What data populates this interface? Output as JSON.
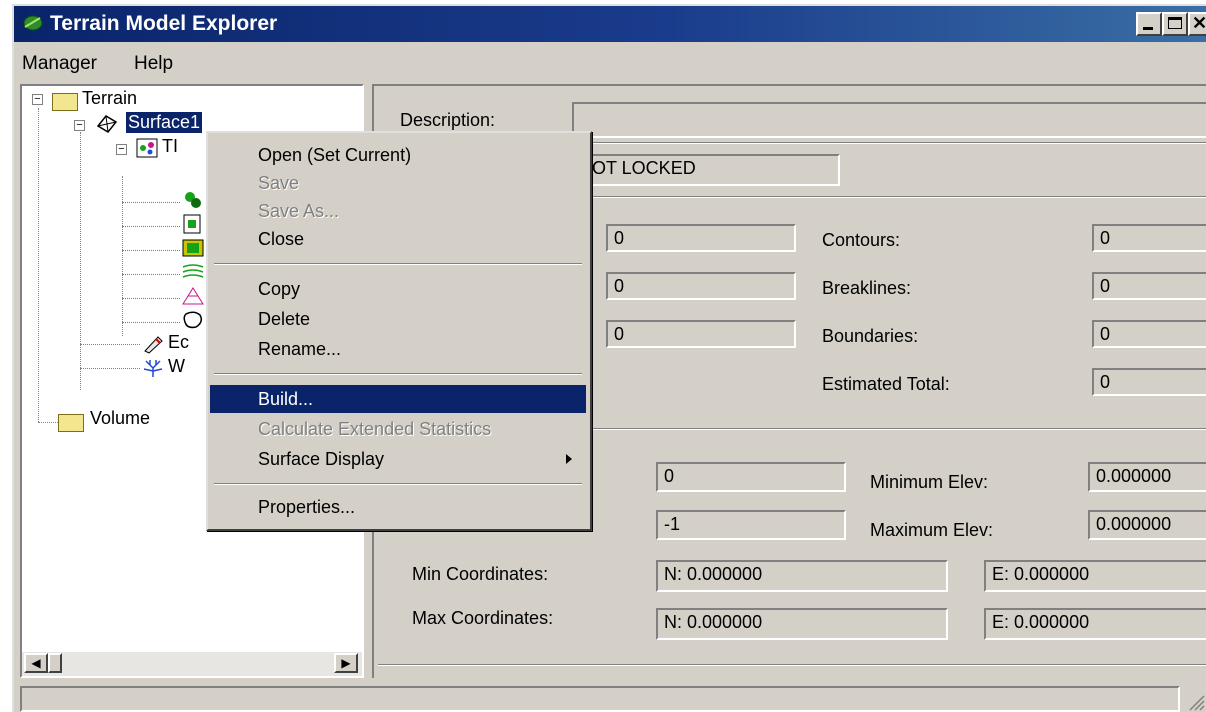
{
  "window": {
    "title": "Terrain Model Explorer",
    "icon": "terrain-leaf-icon"
  },
  "menubar": {
    "items": [
      "Manager",
      "Help"
    ]
  },
  "tree": {
    "nodes": {
      "terrain": "Terrain",
      "surface1": "Surface1",
      "tin": "TI",
      "edit_partial": "Ec",
      "watershed_partial": "W",
      "volume": "Volume"
    }
  },
  "details": {
    "description_label": "Description:",
    "description_value": "",
    "lock_value": "OT LOCKED",
    "left_counts": [
      "0",
      "0",
      "0"
    ],
    "contours_label": "Contours:",
    "contours_value": "0",
    "breaklines_label": "Breaklines:",
    "breaklines_value": "0",
    "boundaries_label": "Boundaries:",
    "boundaries_value": "0",
    "estimated_total_label": "Estimated Total:",
    "estimated_total_value": "0",
    "stat_a_value": "0",
    "stat_b_value": "-1",
    "min_elev_label": "Minimum Elev:",
    "min_elev_value": "0.000000",
    "max_elev_label": "Maximum Elev:",
    "max_elev_value": "0.000000",
    "min_coord_label": "Min Coordinates:",
    "min_coord_n": "N: 0.000000",
    "min_coord_e": "E: 0.000000",
    "max_coord_label": "Max Coordinates:",
    "max_coord_n": "N: 0.000000",
    "max_coord_e": "E: 0.000000"
  },
  "context_menu": {
    "open": "Open (Set Current)",
    "save": "Save",
    "save_as": "Save As...",
    "close": "Close",
    "copy": "Copy",
    "delete": "Delete",
    "rename": "Rename...",
    "build": "Build...",
    "calc_stats": "Calculate Extended Statistics",
    "surface_display": "Surface Display",
    "properties": "Properties..."
  },
  "colors": {
    "title_bar": "#0a246a",
    "selection": "#0a246a",
    "face": "#d4d0c8"
  }
}
